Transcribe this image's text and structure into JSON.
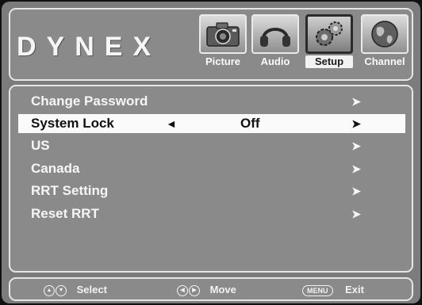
{
  "brand": "DYNEX",
  "tabs": [
    {
      "label": "Picture",
      "icon": "camera-icon"
    },
    {
      "label": "Audio",
      "icon": "headphones-icon"
    },
    {
      "label": "Setup",
      "icon": "gears-icon"
    },
    {
      "label": "Channel",
      "icon": "globe-icon"
    }
  ],
  "selected_tab": "Setup",
  "menu": {
    "items": [
      {
        "label": "Change Password",
        "arrow": "➤"
      },
      {
        "label": "System Lock",
        "left_arrow": "◄",
        "value": "Off",
        "arrow": "➤"
      },
      {
        "label": "US",
        "arrow": "➤"
      },
      {
        "label": "Canada",
        "arrow": "➤"
      },
      {
        "label": "RRT Setting",
        "arrow": "➤"
      },
      {
        "label": "Reset RRT",
        "arrow": "➤"
      }
    ],
    "selected_index": 1
  },
  "footer": {
    "select_label": "Select",
    "move_label": "Move",
    "menu_key": "MENU",
    "exit_label": "Exit"
  },
  "colors": {
    "background": "#7c7c7c",
    "highlight": "#fafafa",
    "text": "#f6f6f6"
  }
}
